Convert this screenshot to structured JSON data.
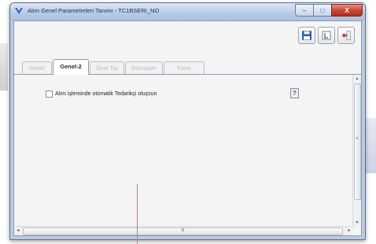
{
  "window": {
    "title": "Alım Genel Parametreleri Tanımı - TC1BSERI_NO",
    "controls": {
      "minimize": "–",
      "maximize": "□",
      "close": "X"
    }
  },
  "toolbar": {
    "buttons": [
      {
        "name": "save-button",
        "icon": "floppy-disk-icon"
      },
      {
        "name": "layout-button",
        "icon": "layout-icon"
      },
      {
        "name": "exit-button",
        "icon": "exit-door-icon"
      }
    ]
  },
  "tabs": [
    {
      "label": "Genel",
      "active": false
    },
    {
      "label": "Genel-2",
      "active": true
    },
    {
      "label": "Özel Tip",
      "active": false
    },
    {
      "label": "Dönüşüm",
      "active": false
    },
    {
      "label": "Form",
      "active": false
    }
  ],
  "panel": {
    "checkbox_label": "Alım işleminde otomatik Tedarikçi oluşsun",
    "checkbox_checked": false,
    "help_label": "?"
  },
  "scrollbars": {
    "up": "▲",
    "down": "▼",
    "left": "◄",
    "right": "►",
    "vgrip": "≡",
    "hgrip": "III"
  },
  "colors": {
    "title_bg": "#b8cce6",
    "close_red": "#c64533",
    "save_blue": "#2f5fa8",
    "exit_red": "#c0392b"
  }
}
